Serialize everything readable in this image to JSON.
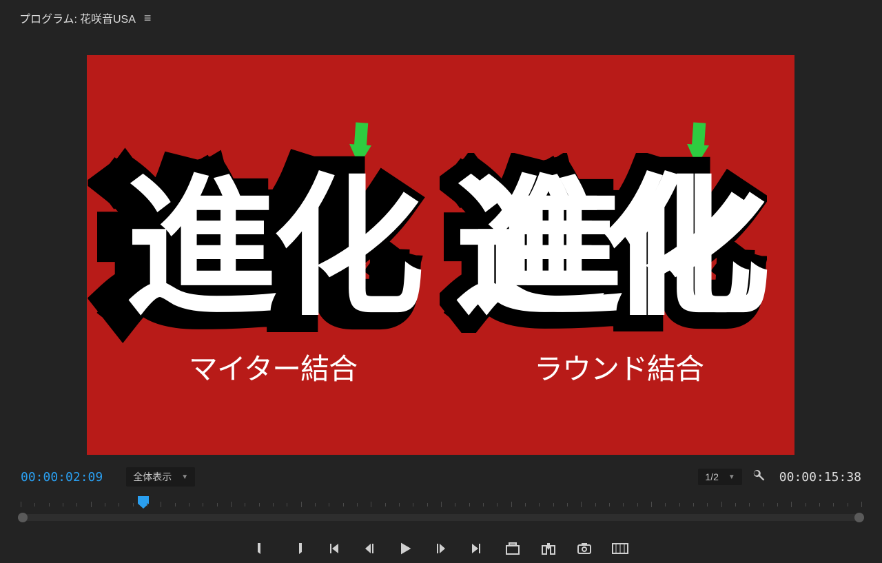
{
  "panel": {
    "title_prefix": "プログラム:",
    "sequence_name": "花咲音USA"
  },
  "monitor": {
    "content": {
      "left": {
        "big_text": "進化",
        "caption": "マイター結合"
      },
      "right": {
        "big_text": "進化",
        "caption": "ラウンド結合"
      }
    }
  },
  "controls": {
    "current_timecode": "00:00:02:09",
    "zoom_select": "全体表示",
    "resolution_select": "1/2",
    "total_timecode": "00:00:15:38"
  },
  "transport": {
    "buttons": [
      "mark-in",
      "mark-out",
      "go-to-in",
      "step-back",
      "play",
      "step-forward",
      "go-to-out",
      "lift",
      "extract",
      "export-frame",
      "comparison-view"
    ]
  },
  "colors": {
    "accent_blue": "#2a9ff0",
    "canvas_background": "#b81b18",
    "arrow": "#2ecc40"
  }
}
